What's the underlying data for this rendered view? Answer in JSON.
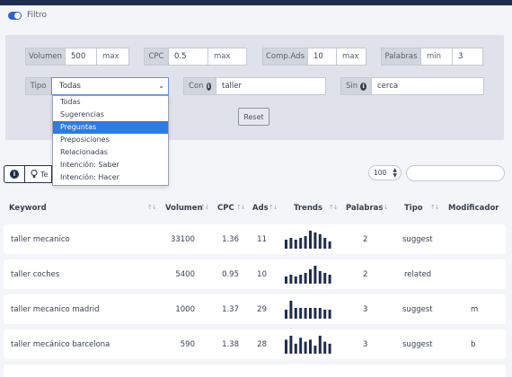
{
  "filter": {
    "label": "Filtro",
    "toggle_on": true
  },
  "filters": {
    "volumen": {
      "label": "Volumen",
      "min": "500",
      "max_placeholder": "max"
    },
    "cpc": {
      "label": "CPC",
      "min": "0.5",
      "max_placeholder": "max"
    },
    "comp_ads": {
      "label": "Comp.Ads",
      "min": "10",
      "max_placeholder": "max"
    },
    "palabras": {
      "label": "Palabras",
      "min_placeholder": "min",
      "max": "3"
    },
    "tipo": {
      "label": "Tipo",
      "selected": "Todas",
      "options": [
        "Todas",
        "Sugerencias",
        "Preguntas",
        "Preposiciones",
        "Relacionadas",
        "Intención: Saber",
        "Intención: Hacer"
      ],
      "highlighted": "Preguntas"
    },
    "con": {
      "label": "Con",
      "value": "taller"
    },
    "sin": {
      "label": "Sin",
      "value": "cerca"
    },
    "reset_label": "Reset"
  },
  "toolbar": {
    "tips_label": "Te",
    "page_size": "100"
  },
  "table": {
    "columns": [
      "Keyword",
      "Volumen",
      "CPC",
      "Ads",
      "Trends",
      "Palabras",
      "Tipo",
      "Modificador"
    ],
    "rows": [
      {
        "keyword": "taller mecanico",
        "volumen": "33100",
        "cpc": "1.36",
        "ads": "11",
        "trends": [
          5,
          6,
          5,
          6,
          7,
          10,
          9,
          8,
          6,
          4
        ],
        "palabras": "2",
        "tipo": "suggest",
        "modificador": ""
      },
      {
        "keyword": "taller coches",
        "volumen": "5400",
        "cpc": "0.95",
        "ads": "10",
        "trends": [
          4,
          5,
          4,
          5,
          6,
          8,
          10,
          7,
          6,
          5
        ],
        "palabras": "2",
        "tipo": "related",
        "modificador": ""
      },
      {
        "keyword": "taller mecanico madrid",
        "volumen": "1000",
        "cpc": "1.37",
        "ads": "29",
        "trends": [
          5,
          10,
          6,
          6,
          6,
          6,
          6,
          6,
          5,
          5
        ],
        "palabras": "3",
        "tipo": "suggest",
        "modificador": "m"
      },
      {
        "keyword": "taller mecánico barcelona",
        "volumen": "590",
        "cpc": "1.38",
        "ads": "28",
        "trends": [
          7,
          9,
          5,
          8,
          6,
          7,
          4,
          9,
          6,
          5
        ],
        "palabras": "3",
        "tipo": "suggest",
        "modificador": "b"
      }
    ]
  },
  "colors": {
    "accent": "#2c62d9",
    "navy": "#1f2d4e",
    "highlight": "#2d7be5"
  },
  "icons": {
    "info": "info-circle-icon",
    "tips": "lightbulb-icon",
    "sort": "sort-arrows-icon"
  }
}
